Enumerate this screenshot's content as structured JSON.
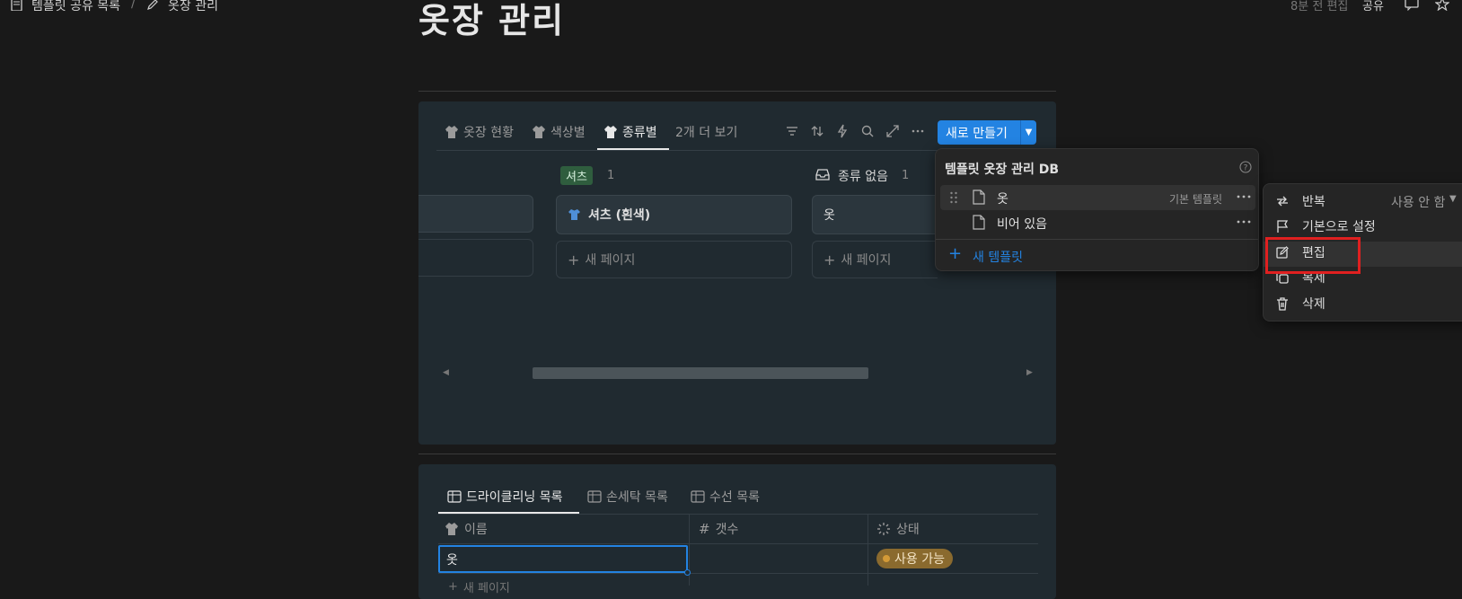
{
  "breadcrumb": {
    "parent": "템플릿 공유 목록",
    "separator": "/",
    "current": "옷장 관리"
  },
  "topbar": {
    "edited": "8분 전 편집",
    "share": "공유"
  },
  "page": {
    "title": "옷장 관리"
  },
  "board": {
    "tabs": [
      {
        "label": "옷장 현황",
        "icon": "dress-icon"
      },
      {
        "label": "색상별",
        "icon": "dress-icon"
      },
      {
        "label": "종류별",
        "icon": "dress-icon",
        "active": true
      },
      {
        "label": "2개 더 보기"
      }
    ],
    "new_button": "새로 만들기",
    "groups": [
      {
        "label": "셔츠",
        "count": "1",
        "tag_color": "#2f5d3e"
      },
      {
        "label": "종류 없음",
        "count": "1"
      }
    ],
    "cards": [
      {
        "title": "셔츠 (흰색)",
        "icon": "shirt-icon"
      },
      {
        "title": "옷"
      }
    ],
    "new_page": "새 페이지"
  },
  "template_menu": {
    "title": "템플릿 옷장 관리 DB",
    "items": [
      {
        "label": "옷",
        "badge": "기본 템플릿"
      },
      {
        "label": "비어 있음"
      }
    ],
    "new_template": "새 템플릿"
  },
  "context_menu": {
    "items": [
      {
        "label": "반복",
        "value": "사용 안 함",
        "icon": "repeat-icon"
      },
      {
        "label": "기본으로 설정",
        "icon": "flag-icon"
      },
      {
        "label": "편집",
        "icon": "edit-icon"
      },
      {
        "label": "복제",
        "icon": "duplicate-icon"
      },
      {
        "label": "삭제",
        "icon": "trash-icon"
      }
    ]
  },
  "table": {
    "tabs": [
      "드라이클리닝 목록",
      "손세탁 목록",
      "수선 목록"
    ],
    "columns": [
      {
        "label": "이름",
        "icon": "dress-icon"
      },
      {
        "label": "갯수",
        "icon": "hash-icon"
      },
      {
        "label": "상태",
        "icon": "status-icon"
      }
    ],
    "rows": [
      {
        "name": "옷",
        "count": "",
        "status": "사용 가능"
      }
    ],
    "new_page": "새 페이지"
  },
  "colors": {
    "accent": "#2383e2",
    "status_bg": "#8a6a2e",
    "highlight": "#e02020"
  }
}
